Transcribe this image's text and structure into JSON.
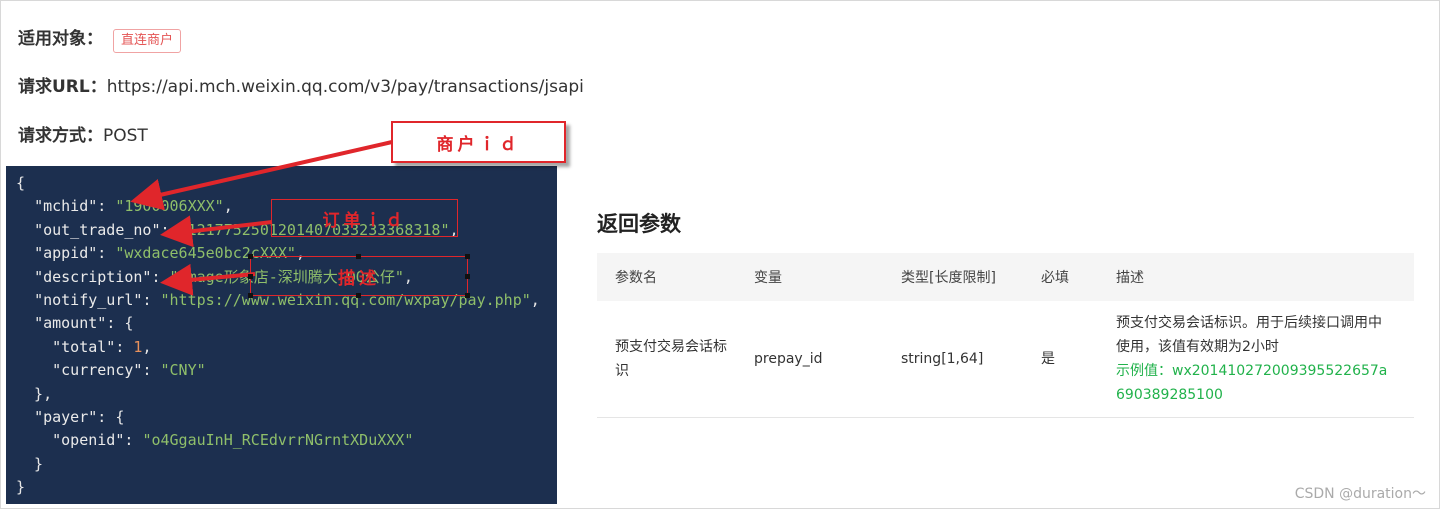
{
  "info": {
    "target_label": "适用对象：",
    "target_tag": "直连商户",
    "url_label": "请求URL：",
    "url_value": "https://api.mch.weixin.qq.com/v3/pay/transactions/jsapi",
    "method_label": "请求方式：",
    "method_value": "POST"
  },
  "code": {
    "mchid_key": "\"mchid\"",
    "mchid_val": "\"1900006XXX\"",
    "out_trade_no_key": "\"out_trade_no\"",
    "out_trade_no_val": "\"1217752501201407033233368318\"",
    "appid_key": "\"appid\"",
    "appid_val": "\"wxdace645e0bc2cXXX\"",
    "description_key": "\"description\"",
    "description_val": "\"Image形象店-深圳腾大-QQ公仔\"",
    "notify_url_key": "\"notify_url\"",
    "notify_url_val": "\"https://www.weixin.qq.com/wxpay/pay.php\"",
    "amount_key": "\"amount\"",
    "total_key": "\"total\"",
    "total_val": "1",
    "currency_key": "\"currency\"",
    "currency_val": "\"CNY\"",
    "payer_key": "\"payer\"",
    "openid_key": "\"openid\"",
    "openid_val": "\"o4GgauInH_RCEdvrrNGrntXDuXXX\""
  },
  "callouts": {
    "merchant_id": "商户ｉｄ",
    "order_id": "订单ｉｄ",
    "description": "描述"
  },
  "response": {
    "title": "返回参数",
    "headers": [
      "参数名",
      "变量",
      "类型[长度限制]",
      "必填",
      "描述"
    ],
    "row": {
      "name": "预支付交易会话标识",
      "variable": "prepay_id",
      "type": "string[1,64]",
      "required": "是",
      "desc": "预支付交易会话标识。用于后续接口调用中使用，该值有效期为2小时",
      "example": "示例值：wx201410272009395522657a690389285100"
    }
  },
  "watermark": "CSDN @duration～",
  "colors": {
    "code_bg": "#1c2f4f",
    "string": "#8fbf6a",
    "number": "#e8915c",
    "annotation_red": "#e0262b",
    "example_green": "#21b24b"
  }
}
